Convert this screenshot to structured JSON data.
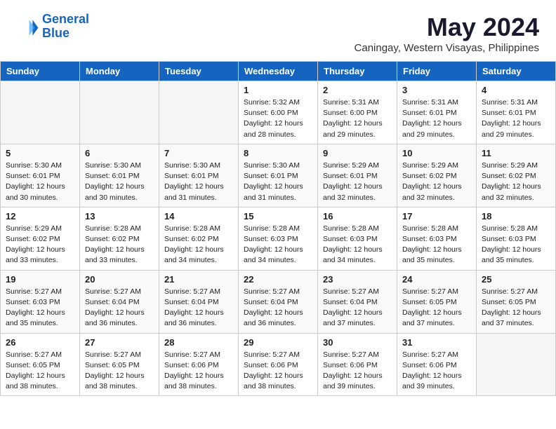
{
  "header": {
    "logo_line1": "General",
    "logo_line2": "Blue",
    "title": "May 2024",
    "subtitle": "Caningay, Western Visayas, Philippines"
  },
  "weekdays": [
    "Sunday",
    "Monday",
    "Tuesday",
    "Wednesday",
    "Thursday",
    "Friday",
    "Saturday"
  ],
  "weeks": [
    {
      "row_class": "row-odd",
      "days": [
        {
          "num": "",
          "info": "",
          "empty": true
        },
        {
          "num": "",
          "info": "",
          "empty": true
        },
        {
          "num": "",
          "info": "",
          "empty": true
        },
        {
          "num": "1",
          "info": "Sunrise: 5:32 AM\nSunset: 6:00 PM\nDaylight: 12 hours\nand 28 minutes.",
          "empty": false
        },
        {
          "num": "2",
          "info": "Sunrise: 5:31 AM\nSunset: 6:00 PM\nDaylight: 12 hours\nand 29 minutes.",
          "empty": false
        },
        {
          "num": "3",
          "info": "Sunrise: 5:31 AM\nSunset: 6:01 PM\nDaylight: 12 hours\nand 29 minutes.",
          "empty": false
        },
        {
          "num": "4",
          "info": "Sunrise: 5:31 AM\nSunset: 6:01 PM\nDaylight: 12 hours\nand 29 minutes.",
          "empty": false
        }
      ]
    },
    {
      "row_class": "row-even",
      "days": [
        {
          "num": "5",
          "info": "Sunrise: 5:30 AM\nSunset: 6:01 PM\nDaylight: 12 hours\nand 30 minutes.",
          "empty": false
        },
        {
          "num": "6",
          "info": "Sunrise: 5:30 AM\nSunset: 6:01 PM\nDaylight: 12 hours\nand 30 minutes.",
          "empty": false
        },
        {
          "num": "7",
          "info": "Sunrise: 5:30 AM\nSunset: 6:01 PM\nDaylight: 12 hours\nand 31 minutes.",
          "empty": false
        },
        {
          "num": "8",
          "info": "Sunrise: 5:30 AM\nSunset: 6:01 PM\nDaylight: 12 hours\nand 31 minutes.",
          "empty": false
        },
        {
          "num": "9",
          "info": "Sunrise: 5:29 AM\nSunset: 6:01 PM\nDaylight: 12 hours\nand 32 minutes.",
          "empty": false
        },
        {
          "num": "10",
          "info": "Sunrise: 5:29 AM\nSunset: 6:02 PM\nDaylight: 12 hours\nand 32 minutes.",
          "empty": false
        },
        {
          "num": "11",
          "info": "Sunrise: 5:29 AM\nSunset: 6:02 PM\nDaylight: 12 hours\nand 32 minutes.",
          "empty": false
        }
      ]
    },
    {
      "row_class": "row-odd",
      "days": [
        {
          "num": "12",
          "info": "Sunrise: 5:29 AM\nSunset: 6:02 PM\nDaylight: 12 hours\nand 33 minutes.",
          "empty": false
        },
        {
          "num": "13",
          "info": "Sunrise: 5:28 AM\nSunset: 6:02 PM\nDaylight: 12 hours\nand 33 minutes.",
          "empty": false
        },
        {
          "num": "14",
          "info": "Sunrise: 5:28 AM\nSunset: 6:02 PM\nDaylight: 12 hours\nand 34 minutes.",
          "empty": false
        },
        {
          "num": "15",
          "info": "Sunrise: 5:28 AM\nSunset: 6:03 PM\nDaylight: 12 hours\nand 34 minutes.",
          "empty": false
        },
        {
          "num": "16",
          "info": "Sunrise: 5:28 AM\nSunset: 6:03 PM\nDaylight: 12 hours\nand 34 minutes.",
          "empty": false
        },
        {
          "num": "17",
          "info": "Sunrise: 5:28 AM\nSunset: 6:03 PM\nDaylight: 12 hours\nand 35 minutes.",
          "empty": false
        },
        {
          "num": "18",
          "info": "Sunrise: 5:28 AM\nSunset: 6:03 PM\nDaylight: 12 hours\nand 35 minutes.",
          "empty": false
        }
      ]
    },
    {
      "row_class": "row-even",
      "days": [
        {
          "num": "19",
          "info": "Sunrise: 5:27 AM\nSunset: 6:03 PM\nDaylight: 12 hours\nand 35 minutes.",
          "empty": false
        },
        {
          "num": "20",
          "info": "Sunrise: 5:27 AM\nSunset: 6:04 PM\nDaylight: 12 hours\nand 36 minutes.",
          "empty": false
        },
        {
          "num": "21",
          "info": "Sunrise: 5:27 AM\nSunset: 6:04 PM\nDaylight: 12 hours\nand 36 minutes.",
          "empty": false
        },
        {
          "num": "22",
          "info": "Sunrise: 5:27 AM\nSunset: 6:04 PM\nDaylight: 12 hours\nand 36 minutes.",
          "empty": false
        },
        {
          "num": "23",
          "info": "Sunrise: 5:27 AM\nSunset: 6:04 PM\nDaylight: 12 hours\nand 37 minutes.",
          "empty": false
        },
        {
          "num": "24",
          "info": "Sunrise: 5:27 AM\nSunset: 6:05 PM\nDaylight: 12 hours\nand 37 minutes.",
          "empty": false
        },
        {
          "num": "25",
          "info": "Sunrise: 5:27 AM\nSunset: 6:05 PM\nDaylight: 12 hours\nand 37 minutes.",
          "empty": false
        }
      ]
    },
    {
      "row_class": "row-odd",
      "days": [
        {
          "num": "26",
          "info": "Sunrise: 5:27 AM\nSunset: 6:05 PM\nDaylight: 12 hours\nand 38 minutes.",
          "empty": false
        },
        {
          "num": "27",
          "info": "Sunrise: 5:27 AM\nSunset: 6:05 PM\nDaylight: 12 hours\nand 38 minutes.",
          "empty": false
        },
        {
          "num": "28",
          "info": "Sunrise: 5:27 AM\nSunset: 6:06 PM\nDaylight: 12 hours\nand 38 minutes.",
          "empty": false
        },
        {
          "num": "29",
          "info": "Sunrise: 5:27 AM\nSunset: 6:06 PM\nDaylight: 12 hours\nand 38 minutes.",
          "empty": false
        },
        {
          "num": "30",
          "info": "Sunrise: 5:27 AM\nSunset: 6:06 PM\nDaylight: 12 hours\nand 39 minutes.",
          "empty": false
        },
        {
          "num": "31",
          "info": "Sunrise: 5:27 AM\nSunset: 6:06 PM\nDaylight: 12 hours\nand 39 minutes.",
          "empty": false
        },
        {
          "num": "",
          "info": "",
          "empty": true
        }
      ]
    }
  ]
}
